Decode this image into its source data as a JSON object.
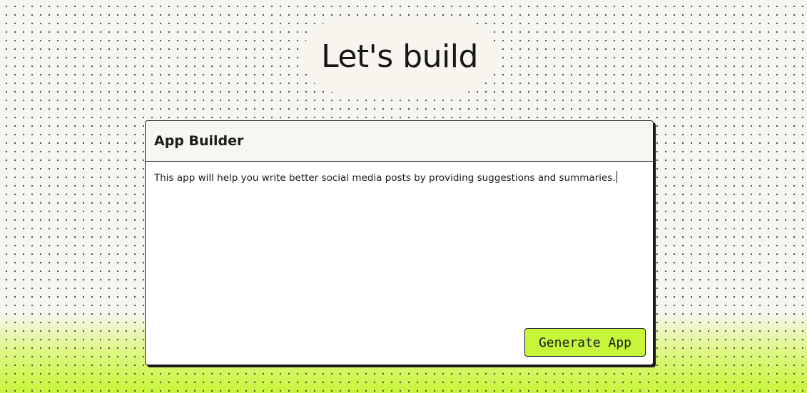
{
  "hero": {
    "title": "Let's build"
  },
  "builder": {
    "title": "App Builder",
    "prompt_value": "This app will help you write better social media posts by providing suggestions and summaries.",
    "generate_label": "Generate App"
  },
  "colors": {
    "accent": "#c6f53a",
    "background": "#f7f5f0",
    "text": "#1a1a1a"
  }
}
